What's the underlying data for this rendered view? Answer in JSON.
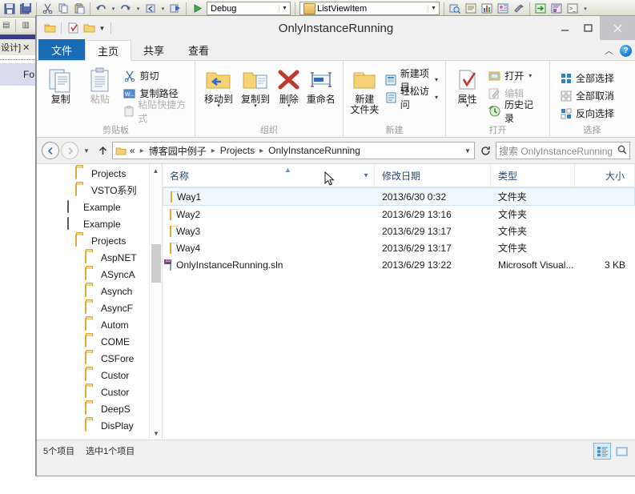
{
  "vs": {
    "toolbar": {
      "config_dropdown": "Debug",
      "target_dropdown": "ListViewItem",
      "icons": [
        "save-icon",
        "save-all-icon",
        "cut-icon",
        "copy-icon",
        "paste-icon",
        "undo-icon",
        "redo-icon",
        "navigate-back-icon",
        "navigate-forward-icon",
        "start-debug-icon"
      ],
      "right_icons": [
        "find-in-files-icon",
        "properties-window-icon",
        "toolbox-icon",
        "solution-explorer-icon",
        "settings-icon",
        "step-into-icon",
        "object-browser-icon",
        "command-window-icon"
      ]
    },
    "designer_tab": "设计]",
    "form_label": "Fo"
  },
  "window": {
    "title": "OnlyInstanceRunning",
    "quick_access": [
      "properties-icon",
      "new-folder-icon",
      "customize-icon"
    ],
    "controls": {
      "minimize": "—",
      "maximize": "▢",
      "close": "✕"
    }
  },
  "ribbon": {
    "tabs": [
      {
        "label": "文件",
        "state": "file-menu"
      },
      {
        "label": "主页",
        "state": "active"
      },
      {
        "label": "共享",
        "state": "normal"
      },
      {
        "label": "查看",
        "state": "normal"
      }
    ],
    "collapse_icon": "chevron-up-icon",
    "help_icon": "help-icon",
    "groups": [
      {
        "name": "剪贴板",
        "big_buttons": [
          {
            "label": "复制",
            "icon": "copy-icon",
            "dim": false
          },
          {
            "label": "粘贴",
            "icon": "paste-icon",
            "dim": true
          }
        ],
        "small_buttons": [
          {
            "label": "剪切",
            "icon": "scissors-icon",
            "dim": false
          },
          {
            "label": "复制路径",
            "icon": "copy-path-icon",
            "dim": false
          },
          {
            "label": "粘贴快捷方式",
            "icon": "paste-shortcut-icon",
            "dim": true
          }
        ]
      },
      {
        "name": "组织",
        "big_buttons": [
          {
            "label": "移动到",
            "icon": "move-to-icon",
            "caret": true
          },
          {
            "label": "复制到",
            "icon": "copy-to-icon",
            "caret": true
          },
          {
            "label": "删除",
            "icon": "delete-icon",
            "caret": true
          },
          {
            "label": "重命名",
            "icon": "rename-icon",
            "caret": false
          }
        ]
      },
      {
        "name": "新建",
        "big_buttons": [
          {
            "label": "新建\n文件夹",
            "icon": "new-folder-icon",
            "caret": false
          }
        ],
        "small_buttons": [
          {
            "label": "新建项目",
            "icon": "new-item-icon",
            "caret": true
          },
          {
            "label": "轻松访问",
            "icon": "easy-access-icon",
            "caret": true
          }
        ]
      },
      {
        "name": "打开",
        "big_buttons": [
          {
            "label": "属性",
            "icon": "properties-icon",
            "caret": true
          }
        ],
        "small_buttons": [
          {
            "label": "打开",
            "icon": "open-icon",
            "caret": true,
            "dim": false
          },
          {
            "label": "编辑",
            "icon": "edit-icon",
            "dim": true
          },
          {
            "label": "历史记录",
            "icon": "history-icon",
            "dim": false
          }
        ]
      },
      {
        "name": "选择",
        "small_buttons": [
          {
            "label": "全部选择",
            "icon": "select-all-icon"
          },
          {
            "label": "全部取消",
            "icon": "select-none-icon"
          },
          {
            "label": "反向选择",
            "icon": "invert-selection-icon"
          }
        ]
      }
    ]
  },
  "navigation": {
    "back_icon": "back-arrow-icon",
    "forward_icon": "forward-arrow-icon",
    "recent_icon": "chevron-down-icon",
    "up_icon": "up-arrow-icon",
    "refresh_icon": "refresh-icon",
    "address": {
      "overflow": "«",
      "crumbs": [
        "博客园中例子",
        "Projects",
        "OnlyInstanceRunning"
      ],
      "dropdown_icon": "chevron-down-icon"
    },
    "search": {
      "placeholder": "搜索 OnlyInstanceRunning",
      "icon": "search-icon"
    }
  },
  "navpane": {
    "items": [
      {
        "label": "Projects",
        "icon": "folder",
        "indent": 3
      },
      {
        "label": "VSTO系列",
        "icon": "folder",
        "indent": 3
      },
      {
        "label": "Example",
        "icon": "books",
        "indent": 2
      },
      {
        "label": "Example",
        "icon": "books",
        "indent": 2
      },
      {
        "label": "Projects",
        "icon": "folder",
        "indent": 3
      },
      {
        "label": "AspNET",
        "icon": "folder",
        "indent": 4
      },
      {
        "label": "ASyncA",
        "icon": "folder",
        "indent": 4
      },
      {
        "label": "Asynch",
        "icon": "folder",
        "indent": 4
      },
      {
        "label": "AsyncF",
        "icon": "folder",
        "indent": 4
      },
      {
        "label": "Autom",
        "icon": "folder",
        "indent": 4
      },
      {
        "label": "COME",
        "icon": "folder",
        "indent": 4
      },
      {
        "label": "CSFore",
        "icon": "folder",
        "indent": 4
      },
      {
        "label": "Custor",
        "icon": "folder",
        "indent": 4
      },
      {
        "label": "Custor",
        "icon": "folder",
        "indent": 4
      },
      {
        "label": "DeepS",
        "icon": "folder",
        "indent": 4
      },
      {
        "label": "DisPlay",
        "icon": "folder",
        "indent": 4
      }
    ],
    "scroll_up_icon": "chevron-up-icon",
    "scroll_down_icon": "chevron-down-icon"
  },
  "filelist": {
    "columns": [
      {
        "label": "名称",
        "sort": "asc"
      },
      {
        "label": "修改日期",
        "sort": null
      },
      {
        "label": "类型",
        "sort": null
      },
      {
        "label": "大小",
        "sort": null
      }
    ],
    "rows": [
      {
        "name": "Way1",
        "date": "2013/6/30 0:32",
        "type": "文件夹",
        "size": "",
        "icon": "folder",
        "selected": true
      },
      {
        "name": "Way2",
        "date": "2013/6/29 13:16",
        "type": "文件夹",
        "size": "",
        "icon": "folder",
        "selected": false
      },
      {
        "name": "Way3",
        "date": "2013/6/29 13:17",
        "type": "文件夹",
        "size": "",
        "icon": "folder",
        "selected": false
      },
      {
        "name": "Way4",
        "date": "2013/6/29 13:17",
        "type": "文件夹",
        "size": "",
        "icon": "folder",
        "selected": false
      },
      {
        "name": "OnlyInstanceRunning.sln",
        "date": "2013/6/29 13:22",
        "type": "Microsoft Visual...",
        "size": "3 KB",
        "icon": "sln",
        "selected": false
      }
    ]
  },
  "statusbar": {
    "item_count": "5个项目",
    "selection": "选中1个项目",
    "view_buttons": [
      {
        "name": "details-view-button",
        "active": true
      },
      {
        "name": "large-icons-view-button",
        "active": false
      }
    ]
  },
  "colors": {
    "accent": "#1a6bb5",
    "selection": "#f2f7fc",
    "folder": "#f3c95c",
    "header_text": "#2b4a6f"
  }
}
